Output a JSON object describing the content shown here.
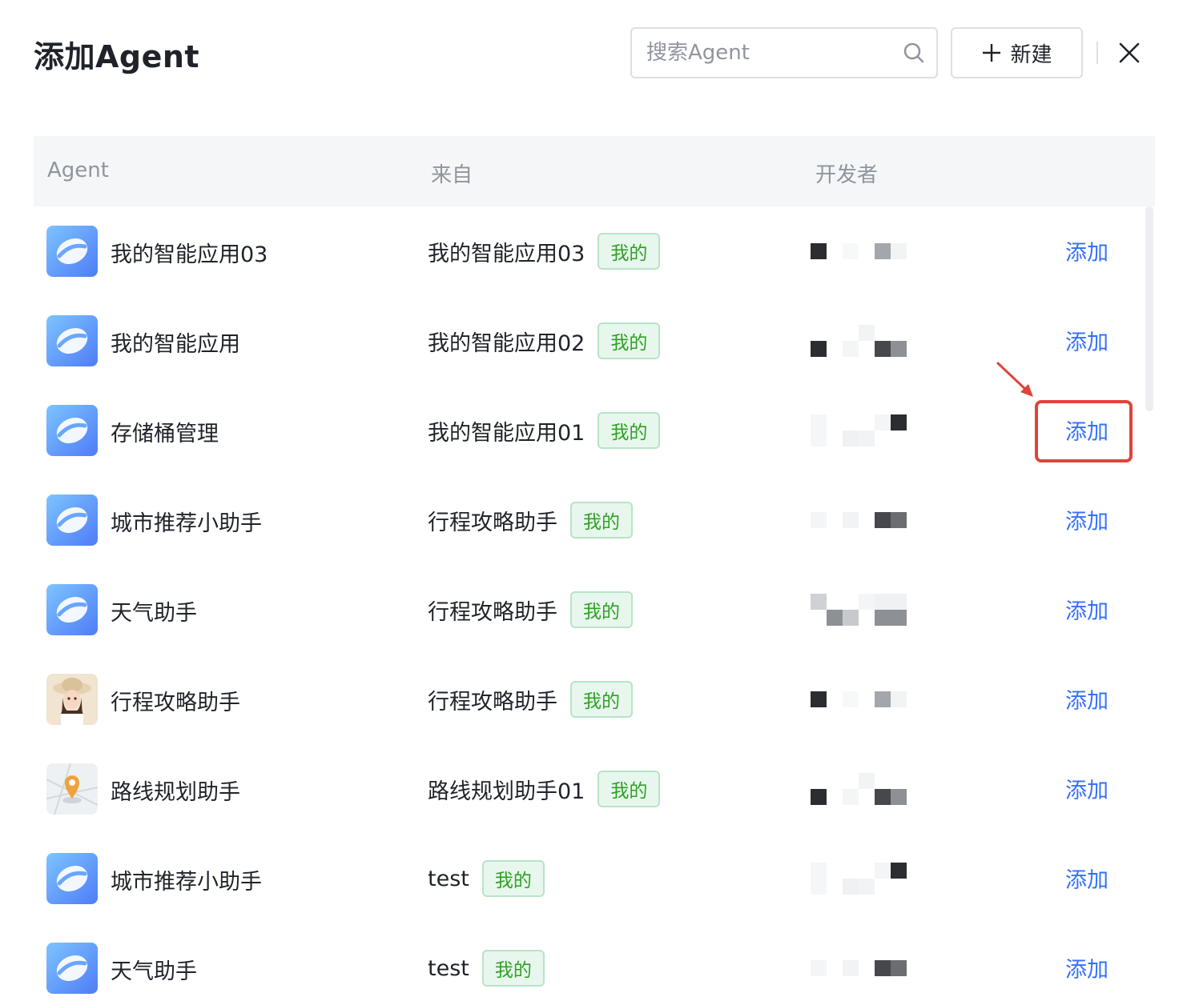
{
  "dialog": {
    "title": "添加Agent",
    "search_placeholder": "搜索Agent",
    "new_label": "新建"
  },
  "table": {
    "headers": [
      "Agent",
      "来自",
      "开发者"
    ],
    "add_label": "添加",
    "rows": [
      {
        "name": "我的智能应用03",
        "from": "我的智能应用03",
        "tag": "我的",
        "avatar": "logo"
      },
      {
        "name": "我的智能应用",
        "from": "我的智能应用02",
        "tag": "我的",
        "avatar": "logo"
      },
      {
        "name": "存储桶管理",
        "from": "我的智能应用01",
        "tag": "我的",
        "avatar": "logo"
      },
      {
        "name": "城市推荐小助手",
        "from": "行程攻略助手",
        "tag": "我的",
        "avatar": "logo"
      },
      {
        "name": "天气助手",
        "from": "行程攻略助手",
        "tag": "我的",
        "avatar": "logo"
      },
      {
        "name": "行程攻略助手",
        "from": "行程攻略助手",
        "tag": "我的",
        "avatar": "person"
      },
      {
        "name": "路线规划助手",
        "from": "路线规划助手01",
        "tag": "我的",
        "avatar": "map-pin"
      },
      {
        "name": "城市推荐小助手",
        "from": "test",
        "tag": "我的",
        "avatar": "logo"
      },
      {
        "name": "天气助手",
        "from": "test",
        "tag": "我的",
        "avatar": "logo"
      }
    ]
  },
  "colors": {
    "link": "#3370ff",
    "tag_text": "#2ea121",
    "tag_bg": "#e8f7ee",
    "highlight": "#e0443a"
  }
}
